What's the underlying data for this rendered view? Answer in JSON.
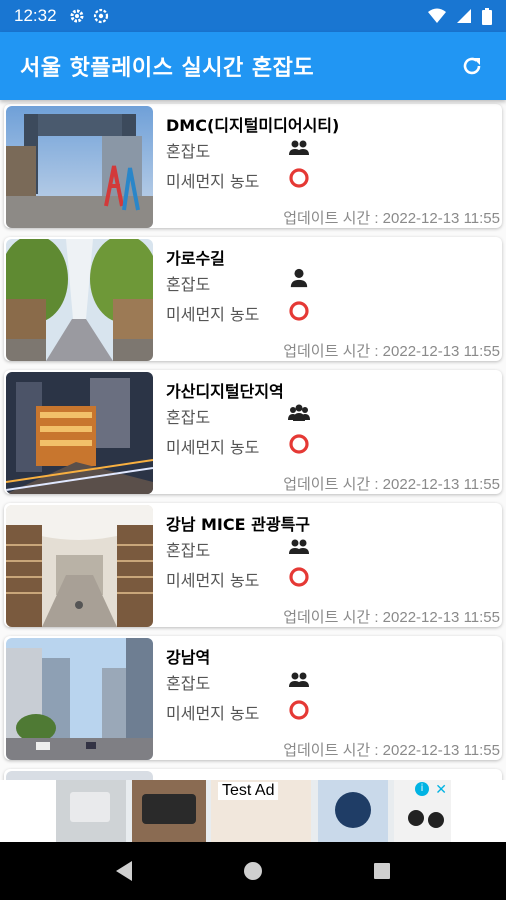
{
  "status_bar": {
    "time": "12:32"
  },
  "app_bar": {
    "title": "서울 핫플레이스 실시간 혼잡도"
  },
  "labels": {
    "crowd": "혼잡도",
    "dust": "미세먼지 농도"
  },
  "places": [
    {
      "name": "DMC(디지털미디어시티)",
      "crowd_icon": "two-people-icon",
      "dust_status": "good",
      "updated": "업데이트 시간 : 2022-12-13 11:55"
    },
    {
      "name": "가로수길",
      "crowd_icon": "single-person-icon",
      "dust_status": "good",
      "updated": "업데이트 시간 : 2022-12-13 11:55"
    },
    {
      "name": "가산디지털단지역",
      "crowd_icon": "group-icon",
      "dust_status": "good",
      "updated": "업데이트 시간 : 2022-12-13 11:55"
    },
    {
      "name": "강남 MICE 관광특구",
      "crowd_icon": "two-people-icon",
      "dust_status": "good",
      "updated": "업데이트 시간 : 2022-12-13 11:55"
    },
    {
      "name": "강남역",
      "crowd_icon": "two-people-icon",
      "dust_status": "good",
      "updated": "업데이트 시간 : 2022-12-13 11:55"
    }
  ],
  "ad": {
    "label": "Test Ad"
  },
  "colors": {
    "primary": "#2196f3",
    "status_bar": "#1976d2",
    "dust_good": "#e53935"
  }
}
